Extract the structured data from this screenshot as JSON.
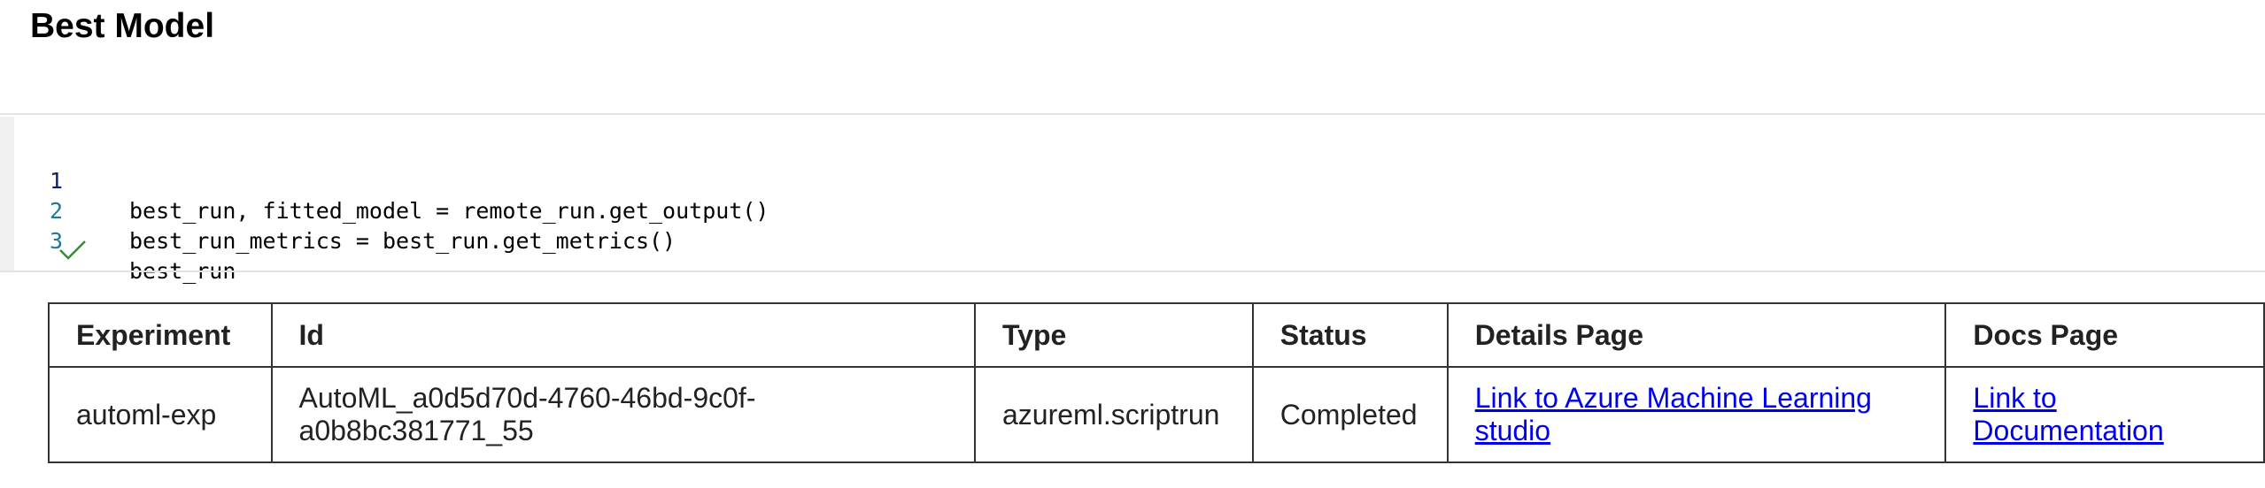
{
  "markdown": {
    "title": "Best Model"
  },
  "code_cell": {
    "lines": [
      {
        "number": "1",
        "code": "best_run, fitted_model = remote_run.get_output()"
      },
      {
        "number": "2",
        "code": "best_run_metrics = best_run.get_metrics()"
      },
      {
        "number": "3",
        "code": "best_run"
      }
    ],
    "status_icon": "checkmark-icon",
    "status_color": "#388a34"
  },
  "output_table": {
    "headers": {
      "experiment": "Experiment",
      "id": "Id",
      "type": "Type",
      "status": "Status",
      "details_page": "Details Page",
      "docs_page": "Docs Page"
    },
    "row": {
      "experiment": "automl-exp",
      "id": "AutoML_a0d5d70d-4760-46bd-9c0f-a0b8bc381771_55",
      "type": "azureml.scriptrun",
      "status": "Completed",
      "details_link": "Link to Azure Machine Learning studio",
      "docs_link": "Link to Documentation"
    },
    "link_color": "#0000ee"
  }
}
